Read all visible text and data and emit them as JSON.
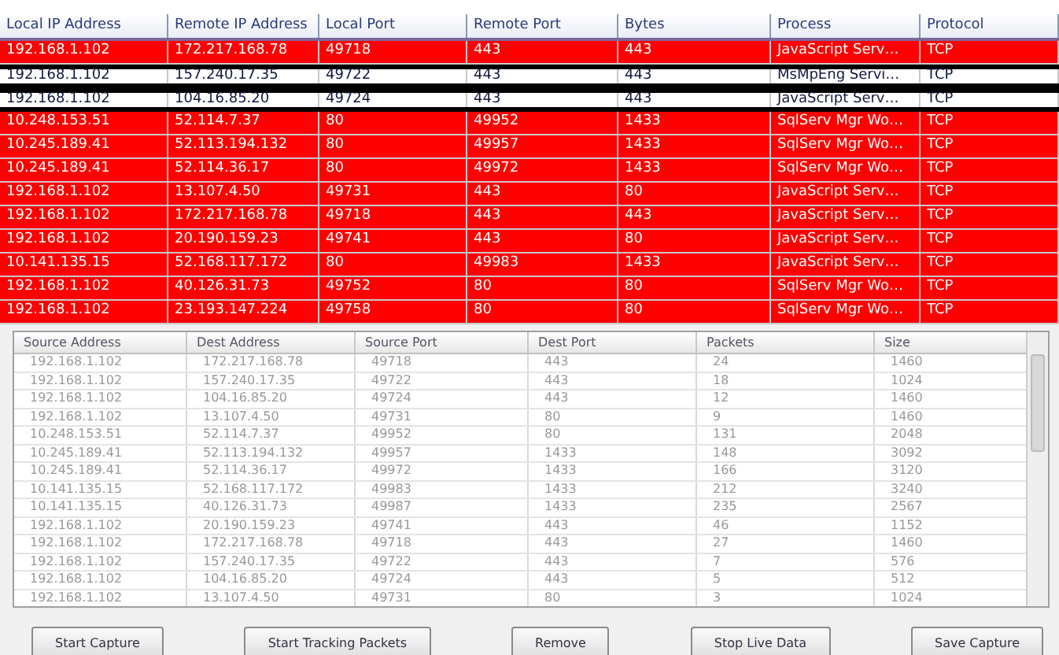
{
  "connections": {
    "columns": [
      "Local IP Address",
      "Remote IP Address",
      "Local Port",
      "Remote Port",
      "Bytes",
      "Process",
      "Protocol"
    ],
    "rows": [
      {
        "cells": [
          "192.168.1.102",
          "172.217.168.78",
          "49718",
          "443",
          "443",
          "JavaScript Serv…",
          "TCP"
        ],
        "selected": false
      },
      {
        "cells": [
          "192.168.1.102",
          "157.240.17.35",
          "49722",
          "443",
          "443",
          "MsMpEng Servi…",
          "TCP"
        ],
        "selected": true
      },
      {
        "cells": [
          "192.168.1.102",
          "104.16.85.20",
          "49724",
          "443",
          "443",
          "JavaScript Serv…",
          "TCP"
        ],
        "selected": true
      },
      {
        "cells": [
          "10.248.153.51",
          "52.114.7.37",
          "80",
          "49952",
          "1433",
          "SqlServ Mgr Wo…",
          "TCP"
        ],
        "selected": false
      },
      {
        "cells": [
          "10.245.189.41",
          "52.113.194.132",
          "80",
          "49957",
          "1433",
          "SqlServ Mgr Wo…",
          "TCP"
        ],
        "selected": false
      },
      {
        "cells": [
          "10.245.189.41",
          "52.114.36.17",
          "80",
          "49972",
          "1433",
          "SqlServ Mgr Wo…",
          "TCP"
        ],
        "selected": false
      },
      {
        "cells": [
          "192.168.1.102",
          "13.107.4.50",
          "49731",
          "443",
          "80",
          "JavaScript Serv…",
          "TCP"
        ],
        "selected": false
      },
      {
        "cells": [
          "192.168.1.102",
          "172.217.168.78",
          "49718",
          "443",
          "443",
          "JavaScript Serv…",
          "TCP"
        ],
        "selected": false
      },
      {
        "cells": [
          "192.168.1.102",
          "20.190.159.23",
          "49741",
          "443",
          "80",
          "JavaScript Serv…",
          "TCP"
        ],
        "selected": false
      },
      {
        "cells": [
          "10.141.135.15",
          "52.168.117.172",
          "80",
          "49983",
          "1433",
          "JavaScript Serv…",
          "TCP"
        ],
        "selected": false
      },
      {
        "cells": [
          "192.168.1.102",
          "40.126.31.73",
          "49752",
          "80",
          "80",
          "SqlServ Mgr Wo…",
          "TCP"
        ],
        "selected": false
      },
      {
        "cells": [
          "192.168.1.102",
          "23.193.147.224",
          "49758",
          "80",
          "80",
          "SqlServ Mgr Wo…",
          "TCP"
        ],
        "selected": false
      }
    ]
  },
  "packets": {
    "columns": [
      "Source Address",
      "Dest Address",
      "Source Port",
      "Dest Port",
      "Packets",
      "Size"
    ],
    "rows": [
      [
        "192.168.1.102",
        "172.217.168.78",
        "49718",
        "443",
        "24",
        "1460"
      ],
      [
        "192.168.1.102",
        "157.240.17.35",
        "49722",
        "443",
        "18",
        "1024"
      ],
      [
        "192.168.1.102",
        "104.16.85.20",
        "49724",
        "443",
        "12",
        "1460"
      ],
      [
        "192.168.1.102",
        "13.107.4.50",
        "49731",
        "80",
        "9",
        "1460"
      ],
      [
        "10.248.153.51",
        "52.114.7.37",
        "49952",
        "80",
        "131",
        "2048"
      ],
      [
        "10.245.189.41",
        "52.113.194.132",
        "49957",
        "1433",
        "148",
        "3092"
      ],
      [
        "10.245.189.41",
        "52.114.36.17",
        "49972",
        "1433",
        "166",
        "3120"
      ],
      [
        "10.141.135.15",
        "52.168.117.172",
        "49983",
        "1433",
        "212",
        "3240"
      ],
      [
        "10.141.135.15",
        "40.126.31.73",
        "49987",
        "1433",
        "235",
        "2567"
      ],
      [
        "192.168.1.102",
        "20.190.159.23",
        "49741",
        "443",
        "46",
        "1152"
      ],
      [
        "192.168.1.102",
        "172.217.168.78",
        "49718",
        "443",
        "27",
        "1460"
      ],
      [
        "192.168.1.102",
        "157.240.17.35",
        "49722",
        "443",
        "7",
        "576"
      ],
      [
        "192.168.1.102",
        "104.16.85.20",
        "49724",
        "443",
        "5",
        "512"
      ],
      [
        "192.168.1.102",
        "13.107.4.50",
        "49731",
        "80",
        "3",
        "1024"
      ]
    ]
  },
  "buttons": [
    "Start Capture",
    "Start Tracking Packets",
    "Remove",
    "Stop Live Data",
    "Save Capture"
  ]
}
